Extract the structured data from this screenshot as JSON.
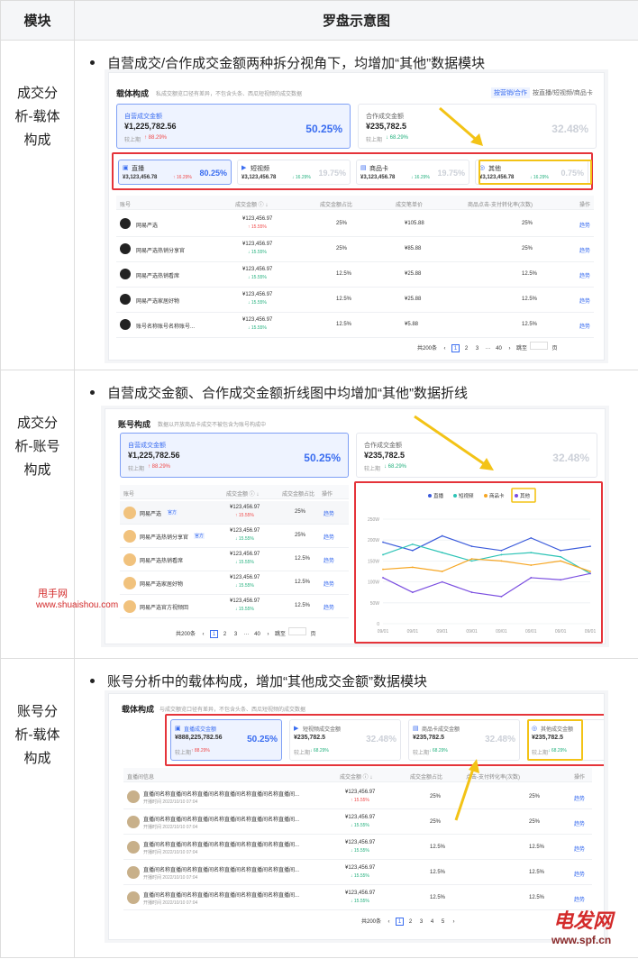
{
  "header": {
    "col1": "模块",
    "col2": "罗盘示意图"
  },
  "rows": [
    {
      "module": [
        "成交分",
        "析-载体",
        "构成"
      ],
      "bullet": "自营成交/合作成交金额两种拆分视角下，均增加“其他”数据模块"
    },
    {
      "module": [
        "成交分",
        "析-账号",
        "构成"
      ],
      "bullet": "自营成交金额、合作成交金额折线图中均增加“其他”数据折线"
    },
    {
      "module": [
        "账号分",
        "析-载体",
        "构成"
      ],
      "bullet": "账号分析中的载体构成，增加“其他成交金额”数据模块"
    }
  ],
  "s1": {
    "title": "载体构成",
    "subtitle": "私成交额览口径有差异，不包含头条、西瓜短视频的成交数据",
    "toggle_active": "按营销/合作",
    "toggle_other": "按直播/短视频/商品卡",
    "self": {
      "label": "自营成交金额",
      "amount": "¥1,225,782.56",
      "cmp": "较上期",
      "chg": "↑ 88.29%",
      "pct": "50.25%"
    },
    "coop": {
      "label": "合作成交金额",
      "amount": "¥235,782.5",
      "cmp": "较上期",
      "chg": "↓ 68.29%",
      "pct": "32.48%"
    },
    "carriers": [
      {
        "icon": "live-icon",
        "label": "直播",
        "amount": "¥3,123,456.78",
        "chg": "↑ 16.29%",
        "pct": "80.25%",
        "active": true
      },
      {
        "icon": "video-icon",
        "label": "短视频",
        "amount": "¥3,123,456.78",
        "chg": "↓ 16.29%",
        "pct": "19.75%"
      },
      {
        "icon": "goods-card-icon",
        "label": "商品卡",
        "amount": "¥3,123,456.78",
        "chg": "↓ 16.29%",
        "pct": "19.75%"
      },
      {
        "icon": "other-icon",
        "label": "其他",
        "amount": "¥3,123,456.78",
        "chg": "↓ 16.29%",
        "pct": "0.75%"
      }
    ],
    "columns": [
      "账号",
      "成交金额 ⓘ ↓",
      "成交金额占比",
      "成交笔单价",
      "商品点击-支付转化率(次数)",
      "操作"
    ],
    "rows": [
      {
        "name": "网易严选",
        "amount": "¥123,456.97",
        "chg": "↑ 15.55%",
        "share": "25%",
        "unit": "¥105.88",
        "conv": "25%",
        "op": "趋势"
      },
      {
        "name": "网易严选热销分享官",
        "amount": "¥123,456.97",
        "chg": "↓ 15.55%",
        "share": "25%",
        "unit": "¥85.88",
        "conv": "25%",
        "op": "趋势"
      },
      {
        "name": "网易严选热销看席",
        "amount": "¥123,456.97",
        "chg": "↓ 15.55%",
        "share": "12.5%",
        "unit": "¥25.88",
        "conv": "12.5%",
        "op": "趋势"
      },
      {
        "name": "网易严选家居好物",
        "amount": "¥123,456.97",
        "chg": "↓ 15.55%",
        "share": "12.5%",
        "unit": "¥25.88",
        "conv": "12.5%",
        "op": "趋势"
      },
      {
        "name": "账号名称账号名称账号...",
        "amount": "¥123,456.97",
        "chg": "↓ 15.55%",
        "share": "12.5%",
        "unit": "¥5.88",
        "conv": "12.5%",
        "op": "趋势"
      }
    ],
    "pager": {
      "total": "共200条",
      "pages": [
        "1",
        "2",
        "3",
        "···",
        "40"
      ],
      "jump": "跳至",
      "unit": "页"
    }
  },
  "s2": {
    "title": "账号构成",
    "subtitle": "数据以开放商品卡成交不被包含为账号构成中",
    "self": {
      "label": "自营成交金额",
      "amount": "¥1,225,782.56",
      "cmp": "较上期",
      "chg": "↑ 88.29%",
      "pct": "50.25%"
    },
    "coop": {
      "label": "合作成交金额",
      "amount": "¥235,782.5",
      "cmp": "较上期",
      "chg": "↓ 68.29%",
      "pct": "32.48%"
    },
    "columns": [
      "账号",
      "成交金额 ⓘ ↓",
      "成交金额占比",
      "操作"
    ],
    "rows": [
      {
        "name": "网易严选",
        "tag": "官方",
        "amount": "¥123,456.97",
        "chg": "↑ 15.55%",
        "share": "25%",
        "op": "趋势"
      },
      {
        "name": "网易严选热销分享官",
        "tag": "官方",
        "amount": "¥123,456.97",
        "chg": "↓ 15.55%",
        "share": "25%",
        "op": "趋势"
      },
      {
        "name": "网易严选热销看席",
        "tag": "",
        "amount": "¥123,456.97",
        "chg": "↓ 15.55%",
        "share": "12.5%",
        "op": "趋势"
      },
      {
        "name": "网易严选家居好物",
        "tag": "",
        "amount": "¥123,456.97",
        "chg": "↓ 15.55%",
        "share": "12.5%",
        "op": "趋势"
      },
      {
        "name": "网易严选官方视频回",
        "tag": "",
        "amount": "¥123,456.97",
        "chg": "↓ 15.55%",
        "share": "12.5%",
        "op": "趋势"
      }
    ],
    "pager": {
      "total": "共200条",
      "pages": [
        "1",
        "2",
        "3",
        "···",
        "40"
      ],
      "jump": "跳至",
      "unit": "页"
    }
  },
  "chart_data": {
    "type": "line",
    "title": "",
    "xlabel": "",
    "ylabel": "",
    "categories": [
      "09/01",
      "09/01",
      "09/01",
      "09/01",
      "09/01",
      "09/01",
      "09/01",
      "09/01"
    ],
    "y_ticks": [
      "0",
      "50W",
      "100W",
      "150W",
      "200W",
      "250W"
    ],
    "ylim": [
      0,
      250
    ],
    "series": [
      {
        "name": "直播",
        "color": "#3b5bdb",
        "values": [
          195,
          175,
          210,
          185,
          175,
          205,
          175,
          185
        ]
      },
      {
        "name": "短视频",
        "color": "#2ec4b6",
        "values": [
          165,
          190,
          170,
          150,
          165,
          170,
          160,
          120
        ]
      },
      {
        "name": "商品卡",
        "color": "#f6a623",
        "values": [
          130,
          135,
          125,
          155,
          150,
          140,
          150,
          125
        ]
      },
      {
        "name": "其他",
        "color": "#7b4fe0",
        "values": [
          110,
          75,
          100,
          75,
          65,
          110,
          105,
          120
        ]
      }
    ],
    "legend": "top-right"
  },
  "s3": {
    "title": "载体构成",
    "subtitle": "与成交额览口径有差异，不包含头条、西瓜短视频的成交数据",
    "cards": [
      {
        "icon": "live-icon",
        "label": "直播成交金额",
        "amount": "¥888,225,782.56",
        "cmp": "较上期",
        "chg": "↑ 88.29%",
        "pct": "50.25%",
        "active": true
      },
      {
        "icon": "video-icon",
        "label": "短视频成交金额",
        "amount": "¥235,782.5",
        "cmp": "较上期",
        "chg": "↓ 68.29%",
        "pct": "32.48%"
      },
      {
        "icon": "goods-card-icon",
        "label": "商品卡成交金额",
        "amount": "¥235,782.5",
        "cmp": "较上期",
        "chg": "↓ 68.29%",
        "pct": "32.48%"
      },
      {
        "icon": "other-icon",
        "label": "其他成交金额",
        "amount": "¥235,782.5",
        "cmp": "较上期",
        "chg": "↓ 68.29%",
        "pct": "32.48%"
      }
    ],
    "columns": [
      "直播间信息",
      "成交金额 ⓘ ↓",
      "成交金额占比",
      "点击-支付转化率(次数)",
      "操作"
    ],
    "rows": [
      {
        "name": "直播间名称直播间名称直播间名称直播间名称直播间名称直播间...",
        "time": "开播时间 2022/10/10 07:04",
        "amount": "¥123,456.97",
        "chg": "↑ 15.55%",
        "share": "25%",
        "conv": "25%",
        "op": "趋势"
      },
      {
        "name": "直播间名称直播间名称直播间名称直播间名称直播间名称直播间...",
        "time": "开播时间 2022/10/10 07:04",
        "amount": "¥123,456.97",
        "chg": "↓ 15.55%",
        "share": "25%",
        "conv": "25%",
        "op": "趋势"
      },
      {
        "name": "直播间名称直播间名称直播间名称直播间名称直播间名称直播间...",
        "time": "开播时间 2022/10/10 07:04",
        "amount": "¥123,456.97",
        "chg": "↓ 15.55%",
        "share": "12.5%",
        "conv": "12.5%",
        "op": "趋势"
      },
      {
        "name": "直播间名称直播间名称直播间名称直播间名称直播间名称直播间...",
        "time": "开播时间 2022/10/10 07:04",
        "amount": "¥123,456.97",
        "chg": "↓ 15.55%",
        "share": "12.5%",
        "conv": "12.5%",
        "op": "趋势"
      },
      {
        "name": "直播间名称直播间名称直播间名称直播间名称直播间名称直播间...",
        "time": "开播时间 2022/10/10 07:04",
        "amount": "¥123,456.97",
        "chg": "↓ 15.55%",
        "share": "12.5%",
        "conv": "12.5%",
        "op": "趋势"
      }
    ],
    "pager": {
      "total": "共200条",
      "pages": [
        "1",
        "2",
        "3",
        "4",
        "5"
      ]
    }
  },
  "watermarks": {
    "wm1": "甩手网",
    "wm2": "www.shuaishou.com",
    "wm3": "电发网",
    "wm4": "www.spf.cn"
  }
}
